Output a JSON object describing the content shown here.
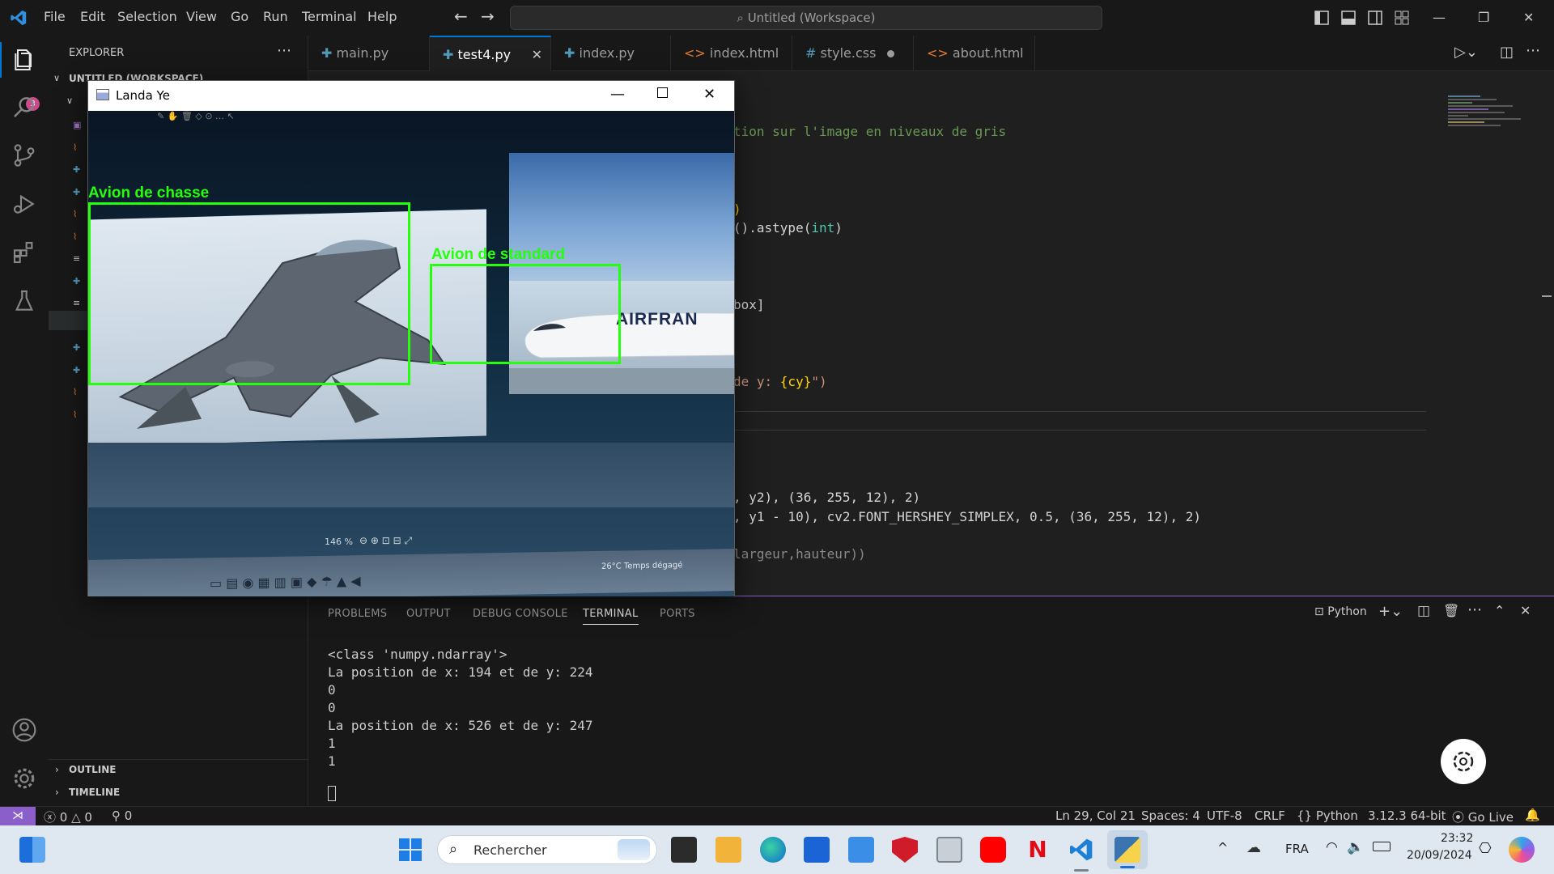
{
  "menu": [
    "File",
    "Edit",
    "Selection",
    "View",
    "Go",
    "Run",
    "Terminal",
    "Help"
  ],
  "command_center": {
    "placeholder": "Untitled (Workspace)"
  },
  "activity": {
    "badge": "3"
  },
  "sidebar": {
    "title": "EXPLORER",
    "workspace": "UNTITLED (WORKSPACE)",
    "outline": "OUTLINE",
    "timeline": "TIMELINE"
  },
  "tabs": [
    {
      "label": "main.py",
      "type": "py"
    },
    {
      "label": "test4.py",
      "type": "py",
      "active": true
    },
    {
      "label": "index.py",
      "type": "py"
    },
    {
      "label": "index.html",
      "type": "html",
      "modified": true
    },
    {
      "label": "style.css",
      "type": "css",
      "modified": true
    },
    {
      "label": "about.html",
      "type": "html",
      "modified": true
    }
  ],
  "code": {
    "l1": "tion sur l'image en niveaux de gris",
    "l2": ")",
    "l3a": "().astype(",
    "l3b": "int",
    "l3c": ")",
    "l4": "box]",
    "l5a": "de y: ",
    "l5b": "{cy}",
    "l5c": "\")",
    "l6": ", y2), (36, 255, 12), 2)",
    "l7": ", y1 - 10), cv2.FONT_HERSHEY_SIMPLEX, 0.5, (36, 255, 12), 2)",
    "l8": "largeur,hauteur))"
  },
  "popup": {
    "title": "Landa Ye",
    "detections": [
      {
        "label": "Avion de chasse"
      },
      {
        "label": "Avion de standard"
      }
    ],
    "screen_text": {
      "zoom": "146 %",
      "weather": "26°C  Temps dégagé",
      "brand": "AIRFRAN"
    }
  },
  "panel": {
    "tabs": [
      "PROBLEMS",
      "OUTPUT",
      "DEBUG CONSOLE",
      "TERMINAL",
      "PORTS"
    ],
    "active_tab": "TERMINAL",
    "shell": "Python",
    "output": [
      "<class 'numpy.ndarray'>",
      "La position de x: 194 et de y: 224",
      "0",
      "0",
      "La position de x: 526 et de y: 247",
      "1",
      "1"
    ]
  },
  "status": {
    "errors": "0",
    "warnings": "0",
    "ports": "0",
    "position": "Ln 29, Col 21",
    "spaces": "Spaces: 4",
    "encoding": "UTF-8",
    "eol": "CRLF",
    "language": "Python",
    "interpreter": "3.12.3 64-bit",
    "golive": "Go Live"
  },
  "taskbar": {
    "search": "Rechercher",
    "lang": "FRA",
    "time": "23:32",
    "date": "20/09/2024"
  },
  "colors": {
    "accent": "#0078d4",
    "detection": "#24ff0c",
    "panel_border": "#8a5fc9"
  }
}
